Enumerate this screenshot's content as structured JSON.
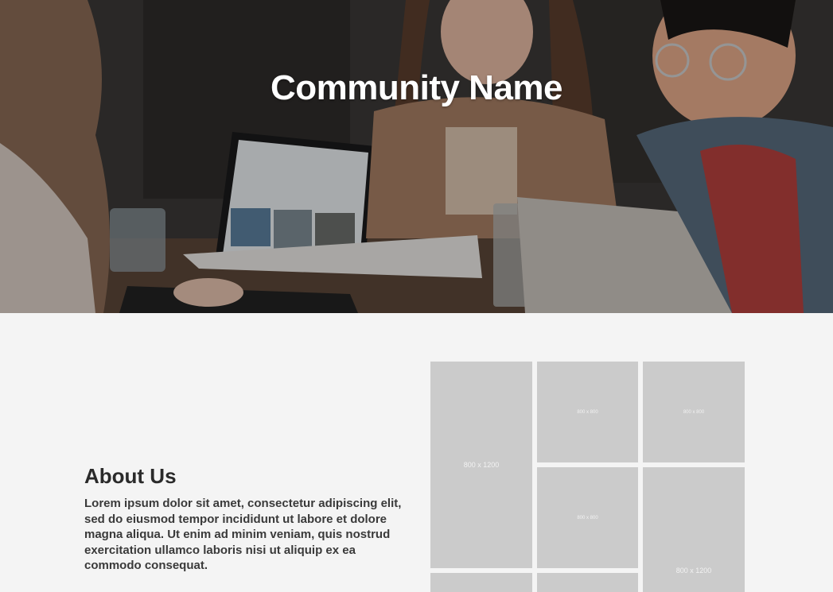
{
  "hero": {
    "title": "Community Name"
  },
  "about": {
    "heading": "About Us",
    "body": "Lorem ipsum dolor sit amet, consectetur adipiscing elit, sed do eiusmod tempor incididunt ut labore et dolore magna aliqua. Ut enim ad minim veniam, quis nostrud exercitation ullamco laboris nisi ut aliquip ex ea commodo consequat."
  },
  "gallery": {
    "tiles": [
      {
        "label": "800 x 1200"
      },
      {
        "label": "800 x 800"
      },
      {
        "label": "800 x 800"
      },
      {
        "label": "800 x 800"
      },
      {
        "label": "800 x 1200"
      },
      {
        "label": ""
      },
      {
        "label": ""
      }
    ]
  },
  "colors": {
    "page_background": "#f4f4f4",
    "placeholder_tile": "#cbcbcb",
    "heading_text": "#2a2a2a",
    "hero_title": "#ffffff"
  }
}
